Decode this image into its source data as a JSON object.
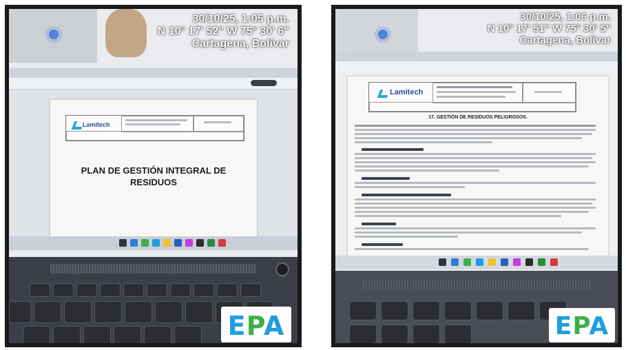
{
  "photos": [
    {
      "stamp": {
        "datetime": "30/10/25, 1:05 p.m.",
        "coordinates": "N 10° 17' 52\"  W 75° 30' 6\"",
        "location": "Cartagena, Bolívar"
      },
      "document": {
        "logo": "Lamitech",
        "title": "PLAN DE GESTIÓN INTEGRAL DE RESIDUOS"
      },
      "watermark": "EPA"
    },
    {
      "stamp": {
        "datetime": "30/10/25, 1:06 p.m.",
        "coordinates": "N 10° 17' 51\"  W 75° 30' 5\"",
        "location": "Cartagena, Bolívar"
      },
      "document": {
        "logo": "Lamitech",
        "section_title": "17. GESTIÓN DE RESIDUOS PELIGROSOS."
      },
      "watermark": "EPA"
    }
  ],
  "colors": {
    "epa_blue": "#1f9de0",
    "epa_green": "#3fae49",
    "logo_blue": "#2a4d9a"
  }
}
